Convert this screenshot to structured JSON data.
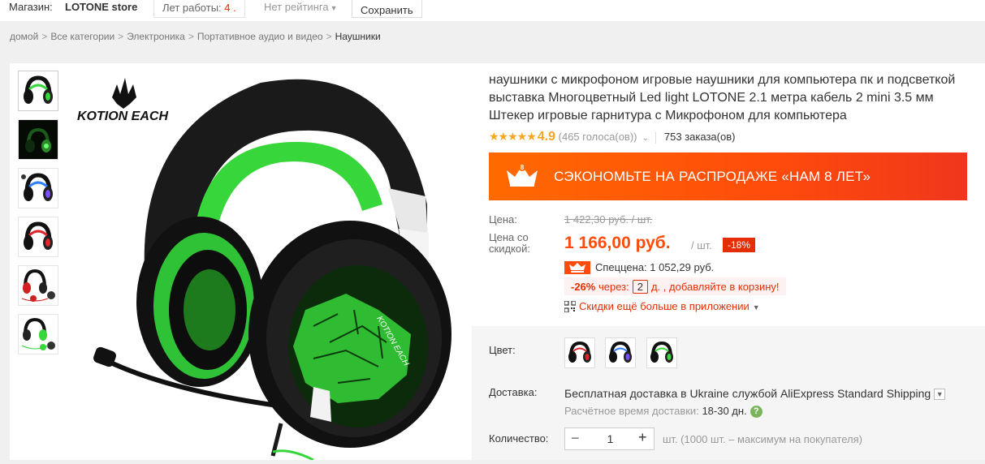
{
  "topbar": {
    "store_label": "Магазин:",
    "store_name": "LOTONE store",
    "years_label": "Лет работы:",
    "years_value": "4 .",
    "rating_label": "Нет рейтинга",
    "save_label": "Сохранить"
  },
  "breadcrumb": [
    "домой",
    "Все категории",
    "Электроника",
    "Портативное аудио и видео",
    "Наушники"
  ],
  "product": {
    "title": "наушники с микрофоном игровые наушники для компьютера пк и подсветкой выставка Многоцветный Led light LOTONE 2.1 метра кабель 2 mini 3.5 мм Штекер игровые гарнитура с Микрофоном для компьютера",
    "brand_logo": "KOTION EACH",
    "rating_stars": "★★★★★",
    "rating_value": "4.9",
    "votes": "(465 голоса(ов))",
    "orders": "753 заказа(ов)"
  },
  "banner": {
    "crown_number": "8",
    "text": "СЭКОНОМЬТЕ НА РАСПРОДАЖЕ «НАМ 8 ЛЕТ»"
  },
  "price": {
    "label": "Цена:",
    "old": "1 422,30 руб. / шт.",
    "discount_label": "Цена со скидкой:",
    "new": "1 166,00 руб.",
    "per_unit": "/ шт.",
    "discount_badge": "-18%",
    "special": "Спеццена: 1 052,29 руб.",
    "promo_pct": "-26%",
    "promo_text_1": "через:",
    "promo_days": "2",
    "promo_text_2": "д. , добавляйте в корзину!",
    "app_discount": "Скидки ещё больше в приложении"
  },
  "color": {
    "label": "Цвет:",
    "options": [
      "red",
      "blue",
      "green"
    ]
  },
  "shipping": {
    "label": "Доставка:",
    "text": "Бесплатная доставка в Ukraine службой AliExpress Standard Shipping",
    "time_label": "Расчётное время доставки:",
    "time_value": "18-30 дн."
  },
  "quantity": {
    "label": "Количество:",
    "value": "1",
    "note": "шт. (1000 шт. – максимум на покупателя)"
  },
  "colors": {
    "accent": "#ff4b0b",
    "price": "#ff4b0b",
    "badge": "#e62e04",
    "star": "#f5a623",
    "headset_green": "#37d63a"
  }
}
